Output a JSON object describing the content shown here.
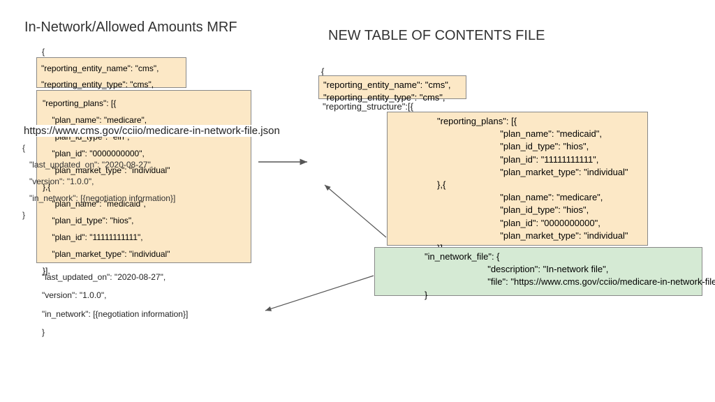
{
  "titles": {
    "left": "In-Network/Allowed Amounts MRF",
    "right": "NEW TABLE OF CONTENTS FILE"
  },
  "left": {
    "open_brace": "{",
    "entity_box": "\"reporting_entity_name\": \"cms\",\n\"reporting_entity_type\": \"cms\",",
    "big_box": "\"reporting_plans\": [{\n    \"plan_name\": \"medicare\",\n    \"plan_id_type\": \"ein\",\n    \"plan_id\": \"0000000000\",\n    \"plan_market_type\": \"individual\"\n},{\n    \"plan_name\": \"medicaid\",\n    \"plan_id_type\": \"hios\",\n    \"plan_id\": \"11111111111\",\n    \"plan_market_type\": \"individual\"\n}],",
    "tail": "\"last_updated_on\": \"2020-08-27\",\n\"version\": \"1.0.0\",\n\"in_network\": [{negotiation information}]\n}",
    "overlay_url": "https://www.cms.gov/cciio/medicare-in-network-file.json",
    "overlay_body": "{\n   \"last_updated_on\": \"2020-08-27\",\n   \"version\": \"1.0.0\",\n   \"in_network\": [{negotiation information}]\n}"
  },
  "right": {
    "open_brace": "{",
    "entity_box": "\"reporting_entity_name\": \"cms\",\n\"reporting_entity_type\": \"cms\",",
    "structure_open": "\"reporting_structure\":[{",
    "plans_box": "                  \"reporting_plans\": [{\n                                           \"plan_name\": \"medicaid\",\n                                           \"plan_id_type\": \"hios\",\n                                           \"plan_id\": \"11111111111\",\n                                           \"plan_market_type\": \"individual\"\n                  },{\n                                           \"plan_name\": \"medicare\",\n                                           \"plan_id_type\": \"hios\",\n                                           \"plan_id\": \"0000000000\",\n                                           \"plan_market_type\": \"individual\"\n                  }],",
    "file_box": "                  \"in_network_file\": {\n                                           \"description\": \"In-network file\",\n                                           \"file\": \"https://www.cms.gov/cciio/medicare-in-network-file.json\"\n                  }"
  }
}
